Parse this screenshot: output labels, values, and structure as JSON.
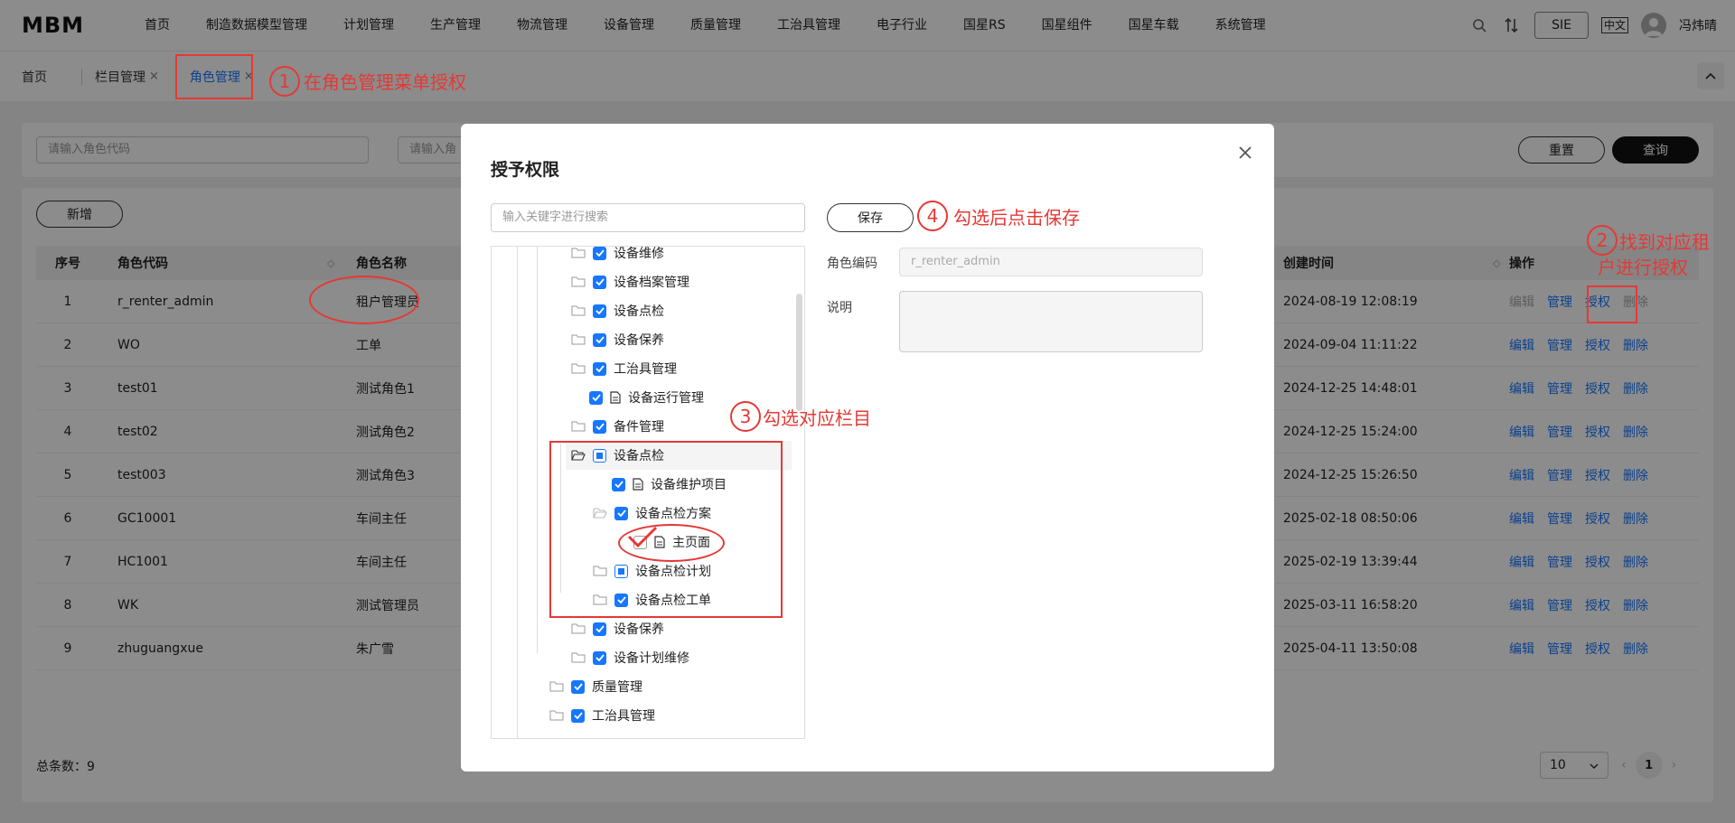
{
  "app": {
    "logo": "MBM"
  },
  "nav": {
    "items": [
      "首页",
      "制造数据模型管理",
      "计划管理",
      "生产管理",
      "物流管理",
      "设备管理",
      "质量管理",
      "工治具管理",
      "电子行业",
      "国星RS",
      "国星组件",
      "国星车载",
      "系统管理"
    ],
    "sie_label": "SIE",
    "lang_label": "中文",
    "username": "冯炜晴"
  },
  "tabs": {
    "home": "首页",
    "items": [
      {
        "label": "栏目管理",
        "close": "×"
      },
      {
        "label": "角色管理",
        "close": "×"
      }
    ]
  },
  "filter": {
    "role_code_placeholder": "请输入角色代码",
    "role_name_placeholder": "请输入角",
    "reset_label": "重置",
    "query_label": "查询"
  },
  "table": {
    "add_label": "新增",
    "headers": {
      "index": "序号",
      "code": "角色代码",
      "name": "角色名称",
      "created": "创建时间",
      "ops": "操作"
    },
    "ops": {
      "edit": "编辑",
      "manage": "管理",
      "grant": "授权",
      "delete": "删除"
    },
    "rows": [
      {
        "idx": "1",
        "code": "r_renter_admin",
        "name": "租户管理员",
        "created": "2024-08-19 12:08:19"
      },
      {
        "idx": "2",
        "code": "WO",
        "name": "工单",
        "created": "2024-09-04 11:11:22"
      },
      {
        "idx": "3",
        "code": "test01",
        "name": "测试角色1",
        "created": "2024-12-25 14:48:01"
      },
      {
        "idx": "4",
        "code": "test02",
        "name": "测试角色2",
        "created": "2024-12-25 15:24:00"
      },
      {
        "idx": "5",
        "code": "test003",
        "name": "测试角色3",
        "created": "2024-12-25 15:26:50"
      },
      {
        "idx": "6",
        "code": "GC10001",
        "name": "车间主任",
        "created": "2025-02-18 08:50:06"
      },
      {
        "idx": "7",
        "code": "HC1001",
        "name": "车间主任",
        "created": "2025-02-19 13:39:44"
      },
      {
        "idx": "8",
        "code": "WK",
        "name": "测试管理员",
        "created": "2025-03-11 16:58:20"
      },
      {
        "idx": "9",
        "code": "zhuguangxue",
        "name": "朱广雪",
        "created": "2025-04-11 13:50:08"
      }
    ],
    "total_label": "总条数：9",
    "page_size": "10",
    "current_page": "1"
  },
  "modal": {
    "title": "授予权限",
    "search_placeholder": "输入关键字进行搜索",
    "save_label": "保存",
    "role_code_label": "角色编码",
    "role_code_value": "r_renter_admin",
    "desc_label": "说明",
    "tree": [
      {
        "label": "设备维修",
        "state": "checked",
        "kind": "folder"
      },
      {
        "label": "设备档案管理",
        "state": "checked",
        "kind": "folder"
      },
      {
        "label": "设备点检",
        "state": "checked",
        "kind": "folder"
      },
      {
        "label": "设备保养",
        "state": "checked",
        "kind": "folder"
      },
      {
        "label": "工治具管理",
        "state": "checked",
        "kind": "folder"
      },
      {
        "label": "设备运行管理",
        "state": "checked",
        "kind": "doc"
      },
      {
        "label": "备件管理",
        "state": "checked",
        "kind": "folder"
      },
      {
        "label": "设备点检",
        "state": "half",
        "kind": "folder-open"
      },
      {
        "label": "设备维护项目",
        "state": "checked",
        "kind": "doc"
      },
      {
        "label": "设备点检方案",
        "state": "checked",
        "kind": "folder"
      },
      {
        "label": "主页面",
        "state": "empty",
        "kind": "doc"
      },
      {
        "label": "设备点检计划",
        "state": "half",
        "kind": "folder"
      },
      {
        "label": "设备点检工单",
        "state": "checked",
        "kind": "folder"
      },
      {
        "label": "设备保养",
        "state": "checked",
        "kind": "folder"
      },
      {
        "label": "设备计划维修",
        "state": "checked",
        "kind": "folder"
      },
      {
        "label": "质量管理",
        "state": "checked",
        "kind": "folder"
      },
      {
        "label": "工治具管理",
        "state": "checked",
        "kind": "folder"
      }
    ]
  },
  "annotations": {
    "step1_num": "1",
    "step1_text": "在角色管理菜单授权",
    "step2_num": "2",
    "step2_text_line1": "找到对应租",
    "step2_text_line2": "户进行授权",
    "step3_num": "3",
    "step3_text": "勾选对应栏目",
    "step4_num": "4",
    "step4_text": "勾选后点击保存"
  },
  "colors": {
    "accent": "#1677ff",
    "annotation": "#e53935",
    "mask": "rgba(0,0,0,0.45)"
  }
}
